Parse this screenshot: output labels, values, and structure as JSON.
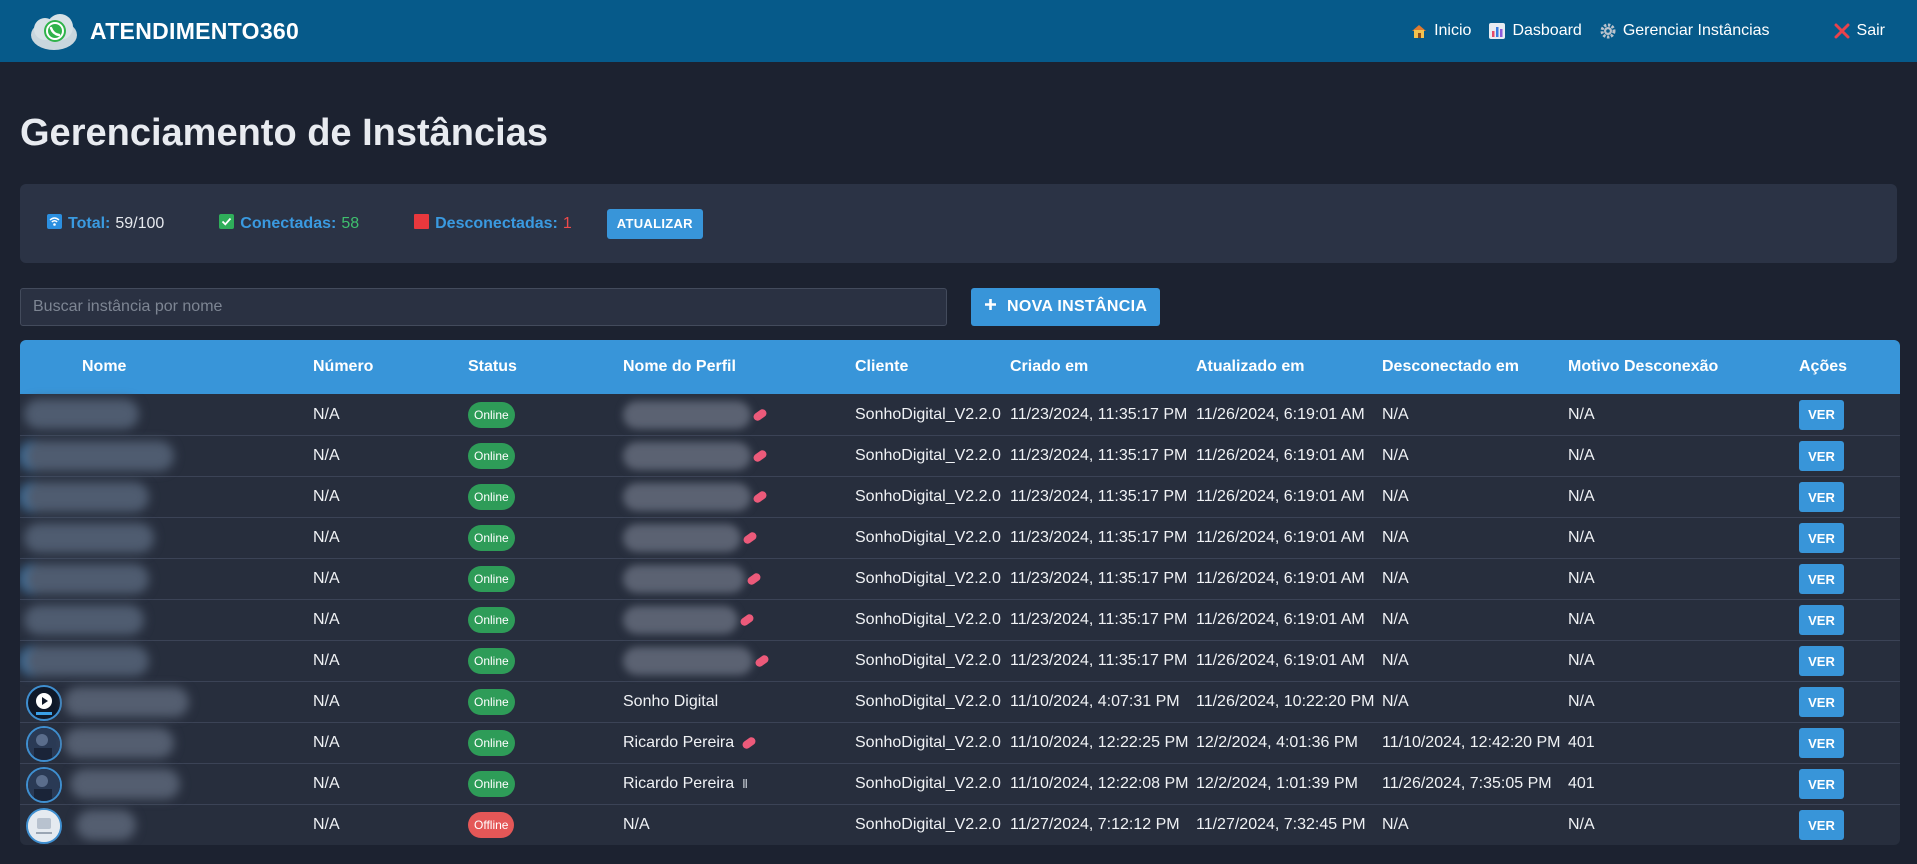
{
  "brand": {
    "name": "ATENDIMENTO360"
  },
  "nav": {
    "items": [
      {
        "label": "Inicio",
        "icon": "house-icon"
      },
      {
        "label": "Dasboard",
        "icon": "bar-chart-icon"
      },
      {
        "label": "Gerenciar Instâncias",
        "icon": "gear-icon"
      }
    ],
    "logout": {
      "label": "Sair",
      "icon": "close-icon"
    }
  },
  "page": {
    "title": "Gerenciamento de Instâncias"
  },
  "stats": {
    "total_label": "Total:",
    "total_value": "59/100",
    "connected_label": "Conectadas:",
    "connected_value": "58",
    "disconnected_label": "Desconectadas:",
    "disconnected_value": "1",
    "refresh_label": "ATUALIZAR"
  },
  "search": {
    "placeholder": "Buscar instância por nome"
  },
  "new_instance": {
    "label": "NOVA INSTÂNCIA"
  },
  "table": {
    "headers": [
      "Nome",
      "Número",
      "Status",
      "Nome do Perfil",
      "Cliente",
      "Criado em",
      "Atualizado em",
      "Desconectado em",
      "Motivo Desconexão",
      "Ações"
    ],
    "action_label": "VER",
    "rows": [
      {
        "numero": "N/A",
        "status": "Online",
        "perfil": "",
        "cliente": "SonhoDigital_V2.2.0",
        "criado": "11/23/2024, 11:35:17 PM",
        "atualizado": "11/26/2024, 6:19:01 AM",
        "desconectado": "N/A",
        "motivo": "N/A"
      },
      {
        "numero": "N/A",
        "status": "Online",
        "perfil": "",
        "cliente": "SonhoDigital_V2.2.0",
        "criado": "11/23/2024, 11:35:17 PM",
        "atualizado": "11/26/2024, 6:19:01 AM",
        "desconectado": "N/A",
        "motivo": "N/A"
      },
      {
        "numero": "N/A",
        "status": "Online",
        "perfil": "",
        "cliente": "SonhoDigital_V2.2.0",
        "criado": "11/23/2024, 11:35:17 PM",
        "atualizado": "11/26/2024, 6:19:01 AM",
        "desconectado": "N/A",
        "motivo": "N/A"
      },
      {
        "numero": "N/A",
        "status": "Online",
        "perfil": "",
        "cliente": "SonhoDigital_V2.2.0",
        "criado": "11/23/2024, 11:35:17 PM",
        "atualizado": "11/26/2024, 6:19:01 AM",
        "desconectado": "N/A",
        "motivo": "N/A"
      },
      {
        "numero": "N/A",
        "status": "Online",
        "perfil": "",
        "cliente": "SonhoDigital_V2.2.0",
        "criado": "11/23/2024, 11:35:17 PM",
        "atualizado": "11/26/2024, 6:19:01 AM",
        "desconectado": "N/A",
        "motivo": "N/A"
      },
      {
        "numero": "N/A",
        "status": "Online",
        "perfil": "",
        "cliente": "SonhoDigital_V2.2.0",
        "criado": "11/23/2024, 11:35:17 PM",
        "atualizado": "11/26/2024, 6:19:01 AM",
        "desconectado": "N/A",
        "motivo": "N/A"
      },
      {
        "numero": "N/A",
        "status": "Online",
        "perfil": "",
        "cliente": "SonhoDigital_V2.2.0",
        "criado": "11/23/2024, 11:35:17 PM",
        "atualizado": "11/26/2024, 6:19:01 AM",
        "desconectado": "N/A",
        "motivo": "N/A"
      },
      {
        "numero": "N/A",
        "status": "Online",
        "perfil": "Sonho Digital",
        "cliente": "SonhoDigital_V2.2.0",
        "criado": "11/10/2024, 4:07:31 PM",
        "atualizado": "11/26/2024, 10:22:20 PM",
        "desconectado": "N/A",
        "motivo": "N/A"
      },
      {
        "numero": "N/A",
        "status": "Online",
        "perfil": "Ricardo Pereira",
        "cliente": "SonhoDigital_V2.2.0",
        "criado": "11/10/2024, 12:22:25 PM",
        "atualizado": "12/2/2024, 4:01:36 PM",
        "desconectado": "11/10/2024, 12:42:20 PM",
        "motivo": "401"
      },
      {
        "numero": "N/A",
        "status": "Online",
        "perfil": "Ricardo Pereira",
        "cliente": "SonhoDigital_V2.2.0",
        "criado": "11/10/2024, 12:22:08 PM",
        "atualizado": "12/2/2024, 1:01:39 PM",
        "desconectado": "11/26/2024, 7:35:05 PM",
        "motivo": "401"
      },
      {
        "numero": "N/A",
        "status": "Offline",
        "perfil": "N/A",
        "cliente": "SonhoDigital_V2.2.0",
        "criado": "11/27/2024, 7:12:12 PM",
        "atualizado": "11/27/2024, 7:32:45 PM",
        "desconectado": "N/A",
        "motivo": "N/A"
      }
    ]
  },
  "colors": {
    "navbar": "#065a8a",
    "accent": "#3895d9",
    "online": "#2e9c58",
    "offline": "#e45757",
    "background": "#1c2230"
  }
}
